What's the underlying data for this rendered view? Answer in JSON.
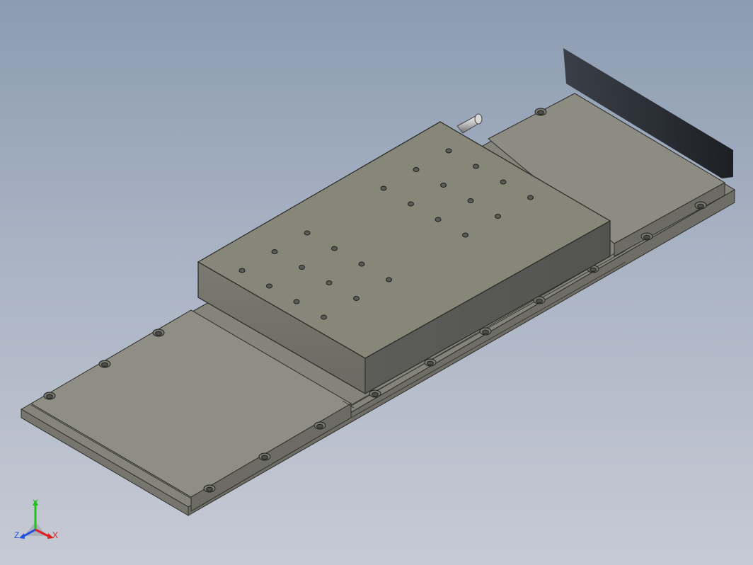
{
  "viewport": {
    "background_top": "#8c9cb1",
    "background_bottom": "#c6cad4"
  },
  "model": {
    "part_color": "#8a8a80",
    "top_face_color": "#848478",
    "side_face_color": "#6c6c64",
    "carriage_mounting_holes_count": 24,
    "base_counterbore_holes_count": 16
  },
  "triad": {
    "x_label": "X",
    "y_label": "Y",
    "z_label": "Z",
    "x_color": "#e02020",
    "y_color": "#20c020",
    "z_color": "#2050e0"
  }
}
